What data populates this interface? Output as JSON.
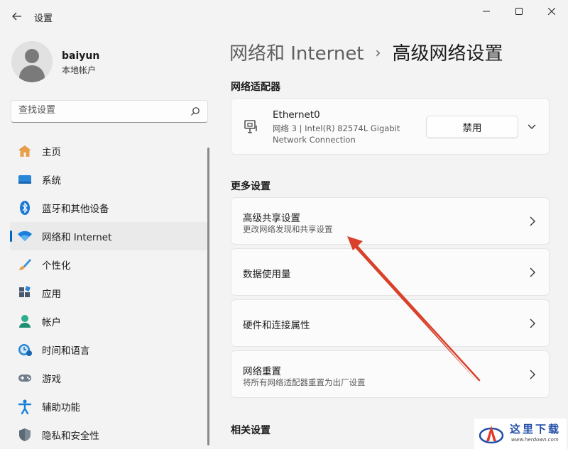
{
  "window": {
    "title": "设置"
  },
  "user": {
    "name": "baiyun",
    "account_type": "本地帐户"
  },
  "search": {
    "placeholder": "查找设置"
  },
  "sidebar": {
    "items": [
      {
        "label": "主页",
        "icon": "home-icon"
      },
      {
        "label": "系统",
        "icon": "system-icon"
      },
      {
        "label": "蓝牙和其他设备",
        "icon": "bluetooth-icon"
      },
      {
        "label": "网络和 Internet",
        "icon": "wifi-icon",
        "active": true
      },
      {
        "label": "个性化",
        "icon": "brush-icon"
      },
      {
        "label": "应用",
        "icon": "apps-icon"
      },
      {
        "label": "帐户",
        "icon": "account-icon"
      },
      {
        "label": "时间和语言",
        "icon": "time-language-icon"
      },
      {
        "label": "游戏",
        "icon": "gamepad-icon"
      },
      {
        "label": "辅助功能",
        "icon": "accessibility-icon"
      },
      {
        "label": "隐私和安全性",
        "icon": "shield-icon"
      }
    ]
  },
  "breadcrumb": {
    "parent": "网络和 Internet",
    "separator": "›",
    "current": "高级网络设置"
  },
  "adapters_section": {
    "title": "网络适配器",
    "adapter": {
      "name": "Ethernet0",
      "description": "网络 3 | Intel(R) 82574L Gigabit Network Connection",
      "button_label": "禁用"
    }
  },
  "more_settings": {
    "title": "更多设置",
    "items": [
      {
        "title": "高级共享设置",
        "subtitle": "更改网络发现和共享设置"
      },
      {
        "title": "数据使用量",
        "subtitle": ""
      },
      {
        "title": "硬件和连接属性",
        "subtitle": ""
      },
      {
        "title": "网络重置",
        "subtitle": "将所有网络适配器重置为出厂设置"
      }
    ]
  },
  "related_settings": {
    "title": "相关设置"
  },
  "watermark": {
    "text": "这里下载",
    "url": "www.herdown.com"
  },
  "colors": {
    "accent": "#0067c0",
    "annotation_arrow": "#d9412b"
  }
}
